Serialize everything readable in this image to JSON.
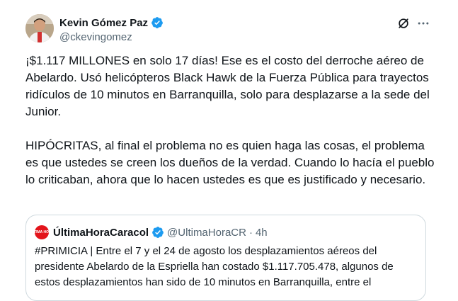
{
  "author": {
    "name": "Kevin Gómez Paz",
    "handle": "@ckevingomez"
  },
  "tweet": {
    "paragraph1": "¡$1.117 MILLONES en solo 17 días! Ese es el costo del derroche aéreo de Abelardo. Usó helicópteros Black Hawk de la Fuerza Pública para trayectos ridículos de 10 minutos en Barranquilla, solo para desplazarse a la sede del Junior.",
    "paragraph2": "HIPÓCRITAS, al final el problema no es quien haga las cosas, el problema es que ustedes se creen los dueños de la verdad. Cuando lo hacía el pueblo lo criticaban, ahora que lo hacen ustedes es que es justificado y necesario."
  },
  "quoted": {
    "avatar_text": "ÚLTIMA HORA",
    "name": "ÚltimaHoraCaracol",
    "handle": "@UltimaHoraCR",
    "separator": "·",
    "time": "4h",
    "text": "#PRIMICIA | Entre el 7 y el 24 de agosto los desplazamientos aéreos del presidente Abelardo de la Espriella han costado $1.117.705.478, algunos de estos desplazamientos han sido de 10 minutos en Barranquilla, entre el"
  },
  "icons": {
    "verified": "verified-badge-icon",
    "grok": "grok-icon",
    "more": "more-icon"
  },
  "colors": {
    "verified": "#1d9bf0",
    "secondary_text": "#536471",
    "quote_border": "#cfd9de",
    "quoted_avatar": "#e3141b"
  }
}
